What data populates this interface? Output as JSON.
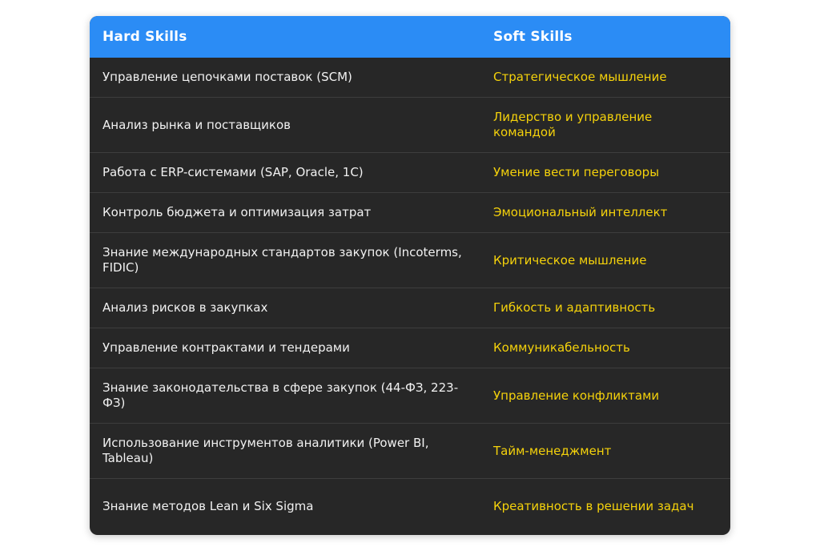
{
  "table": {
    "headers": {
      "hard": "Hard Skills",
      "soft": "Soft Skills"
    },
    "rows": [
      {
        "hard": "Управление цепочками поставок (SCM)",
        "soft": "Стратегическое мышление"
      },
      {
        "hard": "Анализ рынка и поставщиков",
        "soft": "Лидерство и управление командой"
      },
      {
        "hard": "Работа с ERP-системами (SAP, Oracle, 1С)",
        "soft": "Умение вести переговоры"
      },
      {
        "hard": "Контроль бюджета и оптимизация затрат",
        "soft": "Эмоциональный интеллект"
      },
      {
        "hard": "Знание международных стандартов закупок (Incoterms, FIDIC)",
        "soft": "Критическое мышление"
      },
      {
        "hard": "Анализ рисков в закупках",
        "soft": "Гибкость и адаптивность"
      },
      {
        "hard": "Управление контрактами и тендерами",
        "soft": "Коммуникабельность"
      },
      {
        "hard": "Знание законодательства в сфере закупок (44-ФЗ, 223-ФЗ)",
        "soft": "Управление конфликтами"
      },
      {
        "hard": "Использование инструментов аналитики (Power BI, Tableau)",
        "soft": "Тайм-менеджмент"
      },
      {
        "hard": "Знание методов Lean и Six Sigma",
        "soft": "Креативность в решении задач"
      }
    ]
  },
  "colors": {
    "header_bg": "#2b8cf5",
    "body_bg": "#272727",
    "hard_text": "#f1f1f1",
    "soft_text": "#f5d20b"
  }
}
